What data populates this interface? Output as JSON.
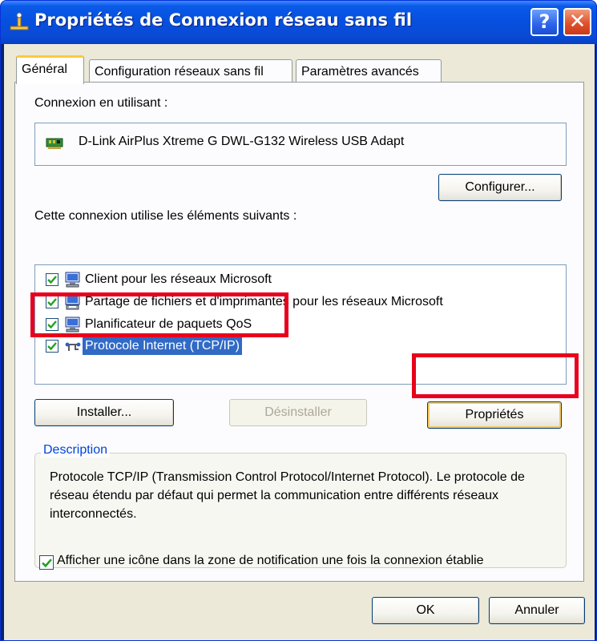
{
  "window": {
    "title": "Propriétés de Connexion réseau sans fil",
    "help_label": "?",
    "close_label": "✕"
  },
  "tabs": [
    {
      "label": "Général",
      "active": true
    },
    {
      "label": "Configuration réseaux sans fil",
      "active": false
    },
    {
      "label": "Paramètres avancés",
      "active": false
    }
  ],
  "general": {
    "connect_using_label": "Connexion en utilisant :",
    "adapter_name": "D-Link AirPlus Xtreme G DWL-G132 Wireless USB Adapt",
    "configure_label": "Configurer...",
    "components_label": "Cette connexion utilise les éléments suivants :",
    "components": [
      {
        "label": "Client pour les réseaux Microsoft",
        "checked": true,
        "icon": "network-client-icon"
      },
      {
        "label": "Partage de fichiers et d'imprimantes pour les réseaux Microsoft",
        "checked": true,
        "icon": "file-sharing-icon"
      },
      {
        "label": "Planificateur de paquets QoS",
        "checked": true,
        "icon": "qos-scheduler-icon"
      },
      {
        "label": "Protocole Internet (TCP/IP)",
        "checked": true,
        "selected": true,
        "icon": "protocol-icon"
      }
    ],
    "install_label": "Installer...",
    "uninstall_label": "Désinstaller",
    "properties_label": "Propriétés",
    "description_title": "Description",
    "description_text": "Protocole TCP/IP (Transmission Control Protocol/Internet Protocol). Le protocole de réseau étendu par défaut qui permet la communication entre différents réseaux interconnectés.",
    "show_icon_label": "Afficher une icône dans la zone de notification une fois la connexion établie",
    "show_icon_checked": true
  },
  "footer": {
    "ok_label": "OK",
    "cancel_label": "Annuler"
  },
  "colors": {
    "highlight_box": "#e8001c",
    "selection": "#316ac5",
    "titlebar": "#0a5ae8"
  }
}
